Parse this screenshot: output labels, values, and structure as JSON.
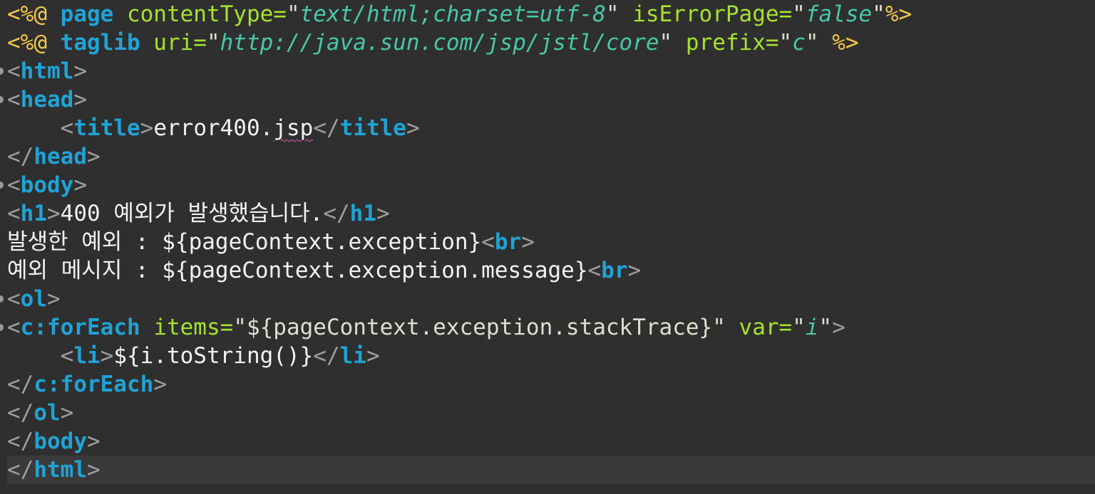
{
  "editor": {
    "language": "JSP",
    "colors": {
      "background": "#2f2f2f",
      "current_line": "#3a3a3a",
      "tag": "#1fa3d6",
      "attribute": "#a6e22e",
      "string": "#46c9a6",
      "directive": "#f5c84c",
      "punctuation": "#9e9e9e",
      "text": "#f2f2f2",
      "spell_underline": "#d65ab4"
    },
    "fold_marker_icon": "fold-marker-icon",
    "lines": [
      [
        {
          "t": "<%@ ",
          "c": "dir"
        },
        {
          "t": "page",
          "c": "tag"
        },
        {
          "t": " contentType=",
          "c": "attr"
        },
        {
          "t": "\"",
          "c": "qt"
        },
        {
          "t": "text/html;charset=utf-8",
          "c": "str"
        },
        {
          "t": "\"",
          "c": "qt"
        },
        {
          "t": " isErrorPage=",
          "c": "attr"
        },
        {
          "t": "\"",
          "c": "qt"
        },
        {
          "t": "false",
          "c": "str"
        },
        {
          "t": "\"",
          "c": "qt"
        },
        {
          "t": "%>",
          "c": "dir"
        }
      ],
      [
        {
          "t": "<%@ ",
          "c": "dir"
        },
        {
          "t": "taglib",
          "c": "tag"
        },
        {
          "t": " uri=",
          "c": "attr"
        },
        {
          "t": "\"",
          "c": "qt"
        },
        {
          "t": "http://java.sun.com/jsp/jstl/core",
          "c": "str"
        },
        {
          "t": "\"",
          "c": "qt"
        },
        {
          "t": " prefix=",
          "c": "attr"
        },
        {
          "t": "\"",
          "c": "qt"
        },
        {
          "t": "c",
          "c": "str"
        },
        {
          "t": "\"",
          "c": "qt"
        },
        {
          "t": " %>",
          "c": "dir"
        }
      ],
      [
        {
          "t": "<",
          "c": "pun"
        },
        {
          "t": "html",
          "c": "tag"
        },
        {
          "t": ">",
          "c": "pun"
        }
      ],
      [
        {
          "t": "<",
          "c": "pun"
        },
        {
          "t": "head",
          "c": "tag"
        },
        {
          "t": ">",
          "c": "pun"
        }
      ],
      [
        {
          "t": "    <",
          "c": "pun"
        },
        {
          "t": "title",
          "c": "tag"
        },
        {
          "t": ">",
          "c": "pun"
        },
        {
          "t": "error400.",
          "c": "txt"
        },
        {
          "t": "jsp",
          "c": "txt",
          "spell": true
        },
        {
          "t": "</",
          "c": "pun"
        },
        {
          "t": "title",
          "c": "tag"
        },
        {
          "t": ">",
          "c": "pun"
        }
      ],
      [
        {
          "t": "</",
          "c": "pun"
        },
        {
          "t": "head",
          "c": "tag"
        },
        {
          "t": ">",
          "c": "pun"
        }
      ],
      [
        {
          "t": "<",
          "c": "pun"
        },
        {
          "t": "body",
          "c": "tag"
        },
        {
          "t": ">",
          "c": "pun"
        }
      ],
      [
        {
          "t": "<",
          "c": "pun"
        },
        {
          "t": "h1",
          "c": "tag"
        },
        {
          "t": ">",
          "c": "pun"
        },
        {
          "t": "400 예외가 발생했습니다.",
          "c": "txt"
        },
        {
          "t": "</",
          "c": "pun"
        },
        {
          "t": "h1",
          "c": "tag"
        },
        {
          "t": ">",
          "c": "pun"
        }
      ],
      [
        {
          "t": "발생한 예외 : ${pageContext.exception}",
          "c": "txt"
        },
        {
          "t": "<",
          "c": "pun"
        },
        {
          "t": "br",
          "c": "tag"
        },
        {
          "t": ">",
          "c": "pun"
        }
      ],
      [
        {
          "t": "예외 메시지 : ${pageContext.exception.message}",
          "c": "txt"
        },
        {
          "t": "<",
          "c": "pun"
        },
        {
          "t": "br",
          "c": "tag"
        },
        {
          "t": ">",
          "c": "pun"
        }
      ],
      [
        {
          "t": "<",
          "c": "pun"
        },
        {
          "t": "ol",
          "c": "tag"
        },
        {
          "t": ">",
          "c": "pun"
        }
      ],
      [
        {
          "t": "<",
          "c": "pun"
        },
        {
          "t": "c:forEach",
          "c": "tag"
        },
        {
          "t": " items=",
          "c": "attr"
        },
        {
          "t": "\"${pageContext.exception.stackTrace}\"",
          "c": "qt"
        },
        {
          "t": " var=",
          "c": "attr"
        },
        {
          "t": "\"",
          "c": "qt"
        },
        {
          "t": "i",
          "c": "str"
        },
        {
          "t": "\"",
          "c": "qt"
        },
        {
          "t": ">",
          "c": "pun"
        }
      ],
      [
        {
          "t": "    <",
          "c": "pun"
        },
        {
          "t": "li",
          "c": "tag"
        },
        {
          "t": ">",
          "c": "pun"
        },
        {
          "t": "${i.toString()}",
          "c": "txt"
        },
        {
          "t": "</",
          "c": "pun"
        },
        {
          "t": "li",
          "c": "tag"
        },
        {
          "t": ">",
          "c": "pun"
        }
      ],
      [
        {
          "t": "</",
          "c": "pun"
        },
        {
          "t": "c:forEach",
          "c": "tag"
        },
        {
          "t": ">",
          "c": "pun"
        }
      ],
      [
        {
          "t": "</",
          "c": "pun"
        },
        {
          "t": "ol",
          "c": "tag"
        },
        {
          "t": ">",
          "c": "pun"
        }
      ],
      [
        {
          "t": "</",
          "c": "pun"
        },
        {
          "t": "body",
          "c": "tag"
        },
        {
          "t": ">",
          "c": "pun"
        }
      ],
      [
        {
          "t": "</",
          "c": "pun"
        },
        {
          "t": "html",
          "c": "tag"
        },
        {
          "t": ">",
          "c": "pun"
        }
      ]
    ]
  }
}
